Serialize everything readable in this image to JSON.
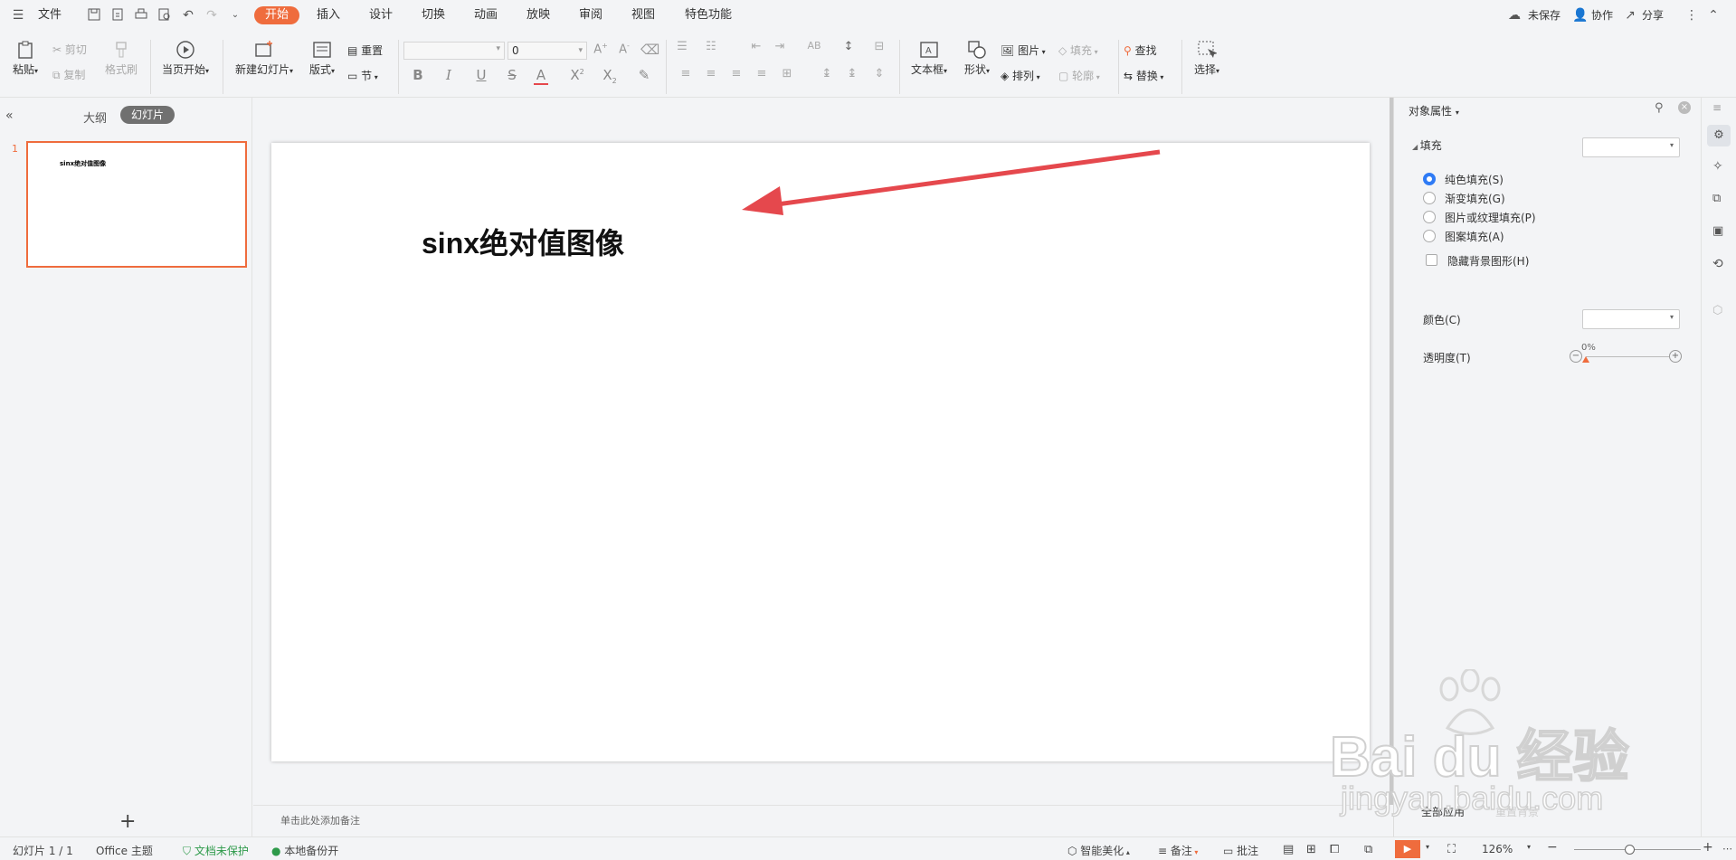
{
  "menubar": {
    "file_label": "文件",
    "tabs": [
      "开始",
      "插入",
      "设计",
      "切换",
      "动画",
      "放映",
      "审阅",
      "视图",
      "特色功能"
    ],
    "active_tab": "开始",
    "unsaved": "未保存",
    "collab": "协作",
    "share": "分享"
  },
  "ribbon": {
    "paste": "粘贴",
    "cut": "剪切",
    "copy": "复制",
    "format_painter": "格式刷",
    "play_from_current": "当页开始",
    "new_slide": "新建幻灯片",
    "layout": "版式",
    "reset": "重置",
    "section": "节",
    "font_size_value": "0",
    "textbox": "文本框",
    "shape": "形状",
    "picture": "图片",
    "arrange": "排列",
    "fill": "填充",
    "outline": "轮廓",
    "find": "查找",
    "replace": "替换",
    "select": "选择"
  },
  "leftpanel": {
    "outline_tab": "大纲",
    "slides_tab": "幻灯片",
    "slide_number": "1",
    "thumb_title": "sinx绝对值图像"
  },
  "slide": {
    "title": "sinx绝对值图像",
    "notes_placeholder": "单击此处添加备注"
  },
  "rightpanel": {
    "title": "对象属性",
    "fill_section": "填充",
    "options": [
      "纯色填充(S)",
      "渐变填充(G)",
      "图片或纹理填充(P)",
      "图案填充(A)"
    ],
    "selected_option": "纯色填充(S)",
    "hide_bg": "隐藏背景图形(H)",
    "color_label": "颜色(C)",
    "transparency_label": "透明度(T)",
    "transparency_value": "0%",
    "transparency_level": 0,
    "apply_all": "全部应用",
    "reset_bg": "重置背景"
  },
  "statusbar": {
    "slide_info": "幻灯片 1 / 1",
    "theme": "Office 主题",
    "doc_protect": "文档未保护",
    "backup": "本地备份开",
    "beautify": "智能美化",
    "notes": "备注",
    "comments": "批注",
    "zoom": "126%"
  },
  "watermark": {
    "brand": "Bai du 经验",
    "url": "jingyan.baidu.com"
  },
  "colors": {
    "accent": "#ef6c3d",
    "radio": "#2f7bf5",
    "arrow": "#e5484d",
    "play": "#ef6c3d"
  }
}
